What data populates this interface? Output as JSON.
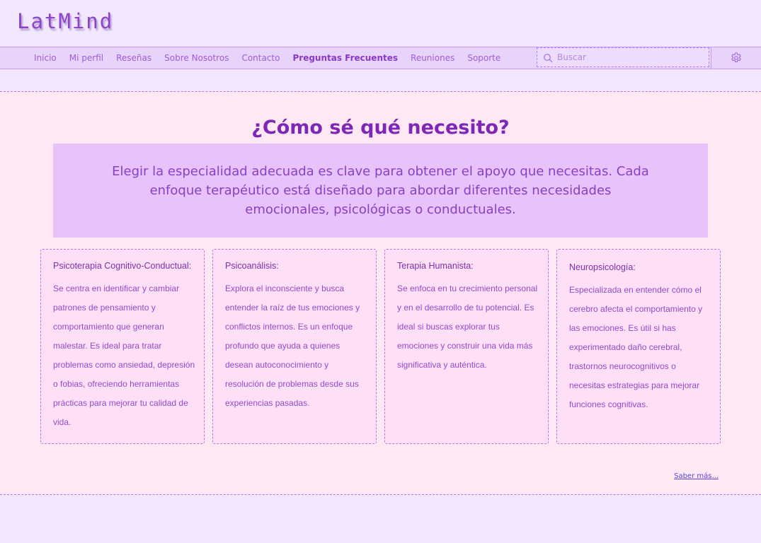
{
  "header": {
    "logo_text": "LatMind"
  },
  "nav": {
    "items": [
      {
        "label": "Inicio",
        "active": false
      },
      {
        "label": "Mi perfil",
        "active": false
      },
      {
        "label": "Reseñas",
        "active": false
      },
      {
        "label": "Sobre Nosotros",
        "active": false
      },
      {
        "label": "Contacto",
        "active": false
      },
      {
        "label": "Preguntas Frecuentes",
        "active": true
      },
      {
        "label": "Reuniones",
        "active": false
      },
      {
        "label": "Soporte",
        "active": false
      }
    ],
    "search_placeholder": "Buscar",
    "search_icon": "search-icon",
    "settings_icon": "gear-icon"
  },
  "main": {
    "title": "¿Cómo sé qué necesito?",
    "intro": "Elegir la especialidad adecuada es clave para obtener el apoyo que necesitas. Cada enfoque terapéutico está diseñado para abordar diferentes necesidades emocionales, psicológicas o conductuales.",
    "cards": [
      {
        "title": "Psicoterapia Cognitivo-Conductual:",
        "body": "Se centra en identificar y cambiar patrones de pensamiento y comportamiento que generan malestar. Es ideal para tratar problemas como ansiedad, depresión o fobias, ofreciendo herramientas prácticas para mejorar tu calidad de vida."
      },
      {
        "title": "Psicoanálisis:",
        "body": "Explora el inconsciente y busca entender la raíz de tus emociones y conflictos internos. Es un enfoque profundo que ayuda a quienes desean autoconocimiento y resolución de problemas desde sus experiencias pasadas."
      },
      {
        "title": "Terapia Humanista:",
        "body": "Se enfoca en tu crecimiento personal y en el desarrollo de tu potencial. Es ideal si buscas explorar tus emociones y construir una vida más significativa y auténtica."
      },
      {
        "title": "Neuropsicología:",
        "body": "Especializada en entender cómo el cerebro afecta el comportamiento y las emociones. Es útil si has experimentado daño cerebral, trastornos neurocognitivos o necesitas estrategias para mejorar funciones cognitivas."
      }
    ],
    "more_link": "Saber más..."
  },
  "colors": {
    "accent": "#7e27b6",
    "nav_bg": "#e8d3fb",
    "content_bg": "#fde8f4",
    "intro_bg": "#e7c2fb",
    "card_bg": "#fde0f6",
    "link": "#5d43d8"
  }
}
